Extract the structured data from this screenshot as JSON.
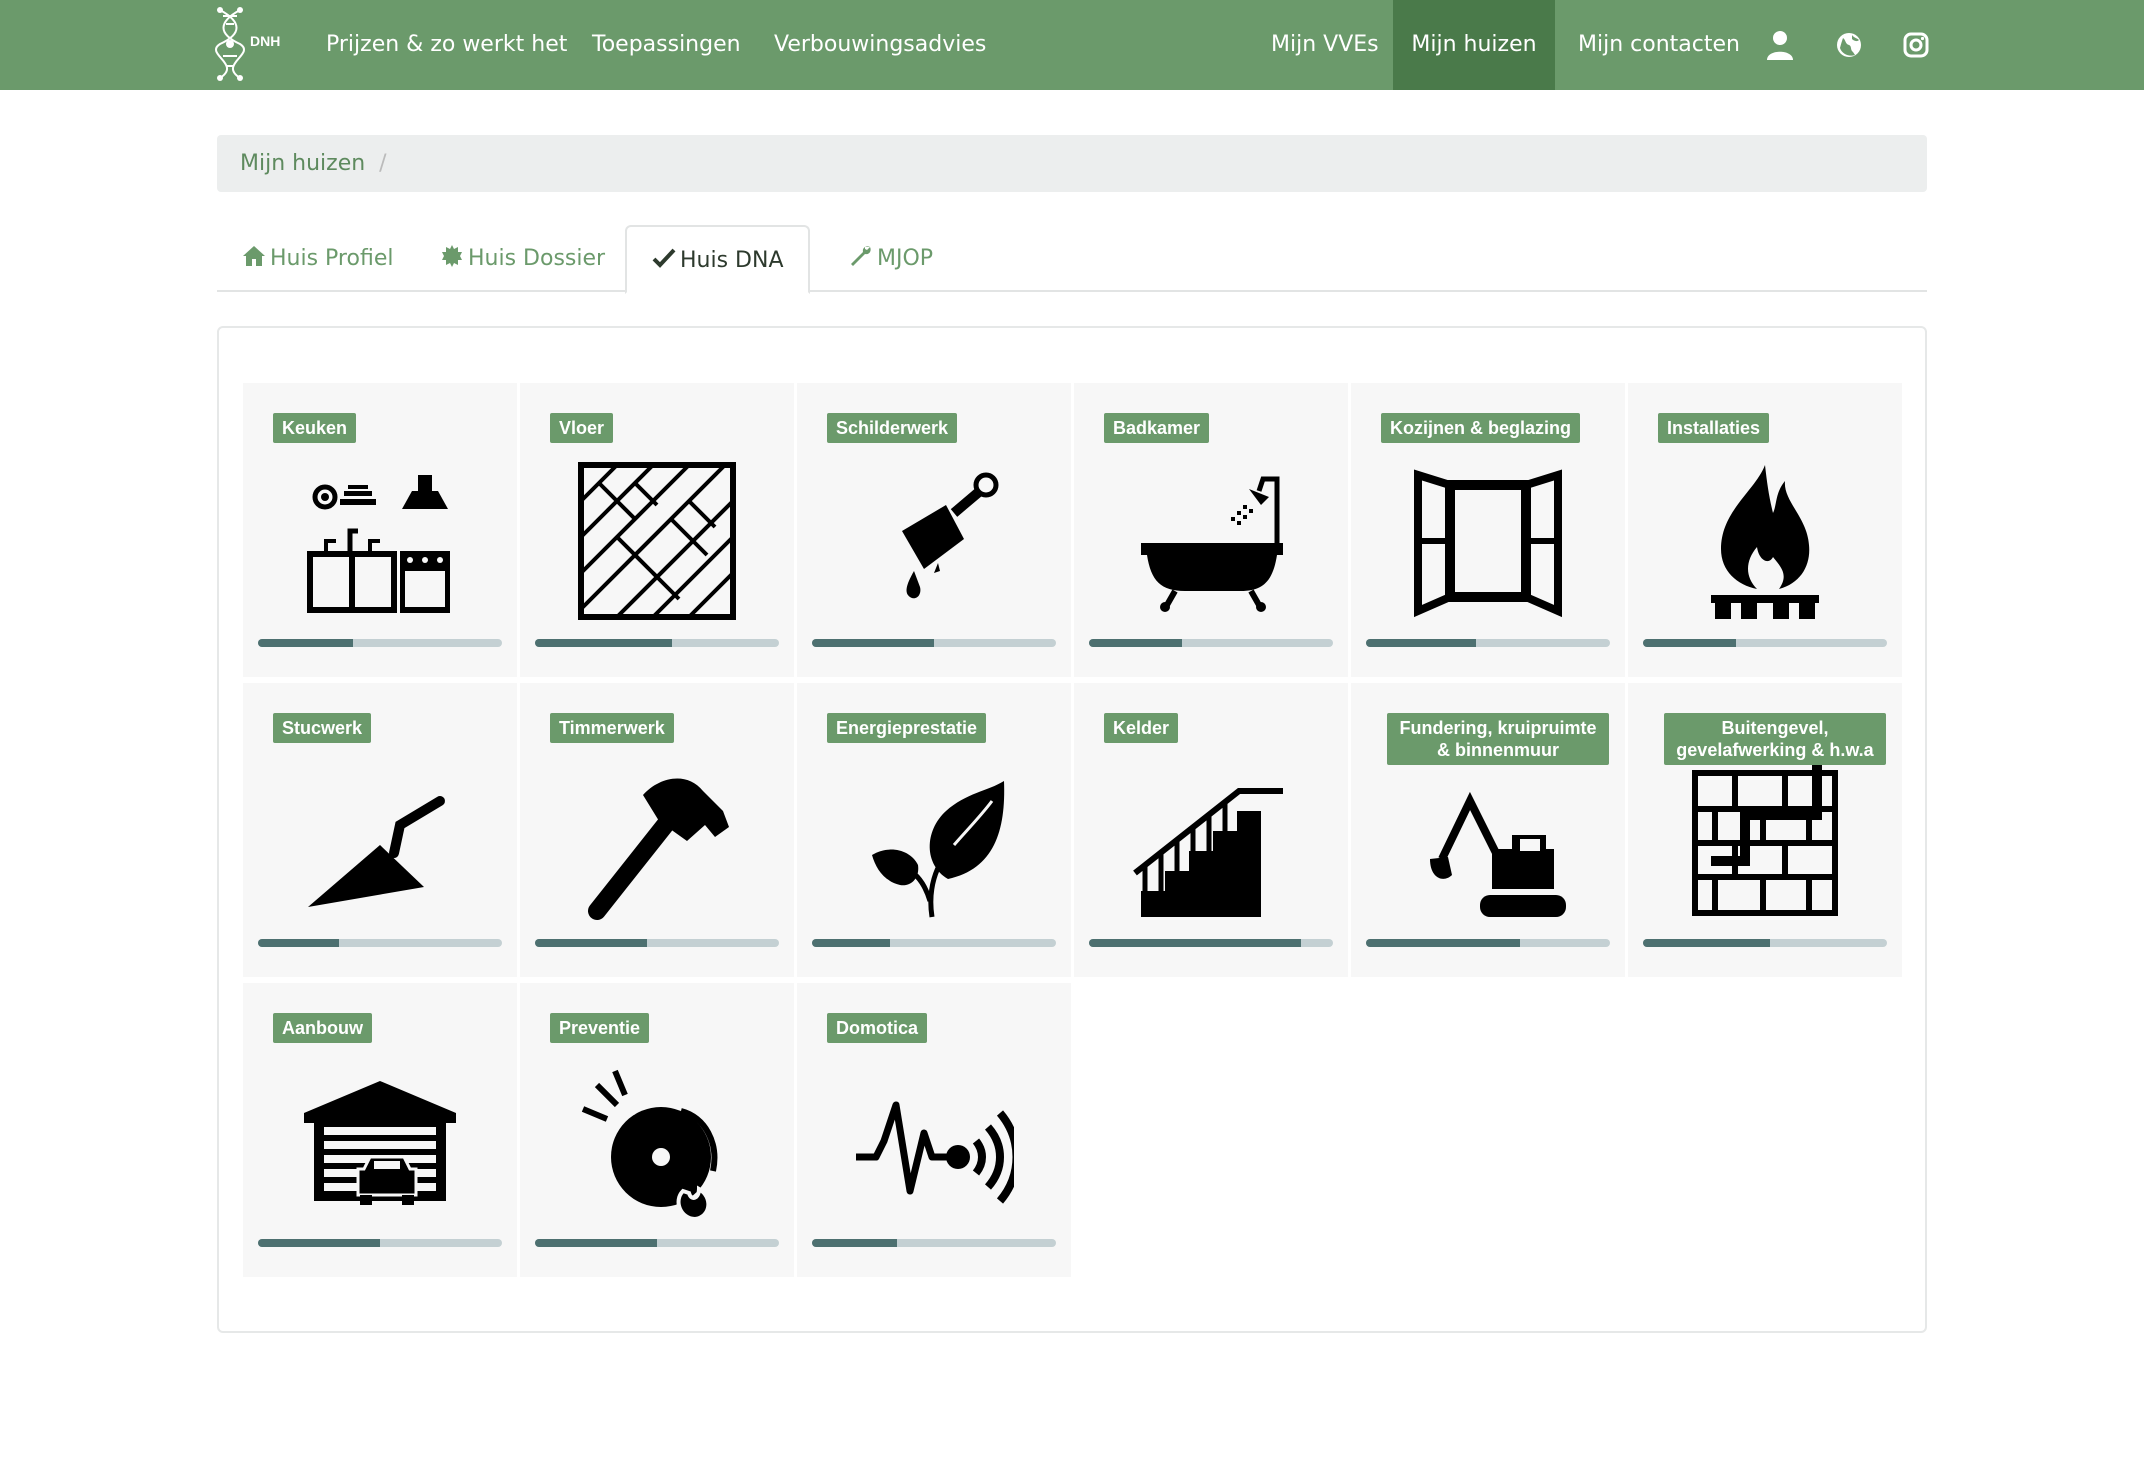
{
  "navbar": {
    "logo_text": "DNH",
    "left_links": [
      "Prijzen & zo werkt het",
      "Toepassingen",
      "Verbouwingsadvies"
    ],
    "right_links": [
      "Mijn VVEs",
      "Mijn huizen",
      "Mijn contacten"
    ],
    "active_link": "Mijn huizen",
    "icons": [
      "user-icon",
      "globe-icon",
      "instagram-icon"
    ]
  },
  "breadcrumb": {
    "items": [
      "Mijn huizen"
    ],
    "separator": "/"
  },
  "tabs": [
    {
      "label": "Huis Profiel",
      "icon": "home-icon",
      "active": false
    },
    {
      "label": "Huis Dossier",
      "icon": "certificate-icon",
      "active": false
    },
    {
      "label": "Huis DNA",
      "icon": "check-icon",
      "active": true
    },
    {
      "label": "MJOP",
      "icon": "wrench-icon",
      "active": false
    }
  ],
  "categories": [
    {
      "label": "Keuken",
      "icon": "kitchen-icon",
      "progress": 0.39
    },
    {
      "label": "Vloer",
      "icon": "floor-icon",
      "progress": 0.56
    },
    {
      "label": "Schilderwerk",
      "icon": "paintbrush-icon",
      "progress": 0.5
    },
    {
      "label": "Badkamer",
      "icon": "bathtub-icon",
      "progress": 0.38
    },
    {
      "label": "Kozijnen & beglazing",
      "icon": "window-icon",
      "progress": 0.45
    },
    {
      "label": "Installaties",
      "icon": "gas-flame-icon",
      "progress": 0.38
    },
    {
      "label": "Stucwerk",
      "icon": "trowel-icon",
      "progress": 0.33
    },
    {
      "label": "Timmerwerk",
      "icon": "hammer-icon",
      "progress": 0.46
    },
    {
      "label": "Energieprestatie",
      "icon": "leaf-icon",
      "progress": 0.32
    },
    {
      "label": "Kelder",
      "icon": "stairs-icon",
      "progress": 0.87
    },
    {
      "label": "Fundering, kruipruimte & binnenmuur",
      "icon": "excavator-icon",
      "progress": 0.63
    },
    {
      "label": "Buitengevel, gevelafwerking & h.w.a",
      "icon": "brick-wall-icon",
      "progress": 0.52
    },
    {
      "label": "Aanbouw",
      "icon": "garage-icon",
      "progress": 0.5
    },
    {
      "label": "Preventie",
      "icon": "smoke-alarm-icon",
      "progress": 0.5
    },
    {
      "label": "Domotica",
      "icon": "sensor-icon",
      "progress": 0.35
    }
  ],
  "colors": {
    "brand_green": "#6b9a6b",
    "nav_active": "#4a7a4a",
    "progress_fill": "#4d7070",
    "progress_track": "#c4d0d3",
    "tile_bg": "#f7f7f7"
  }
}
